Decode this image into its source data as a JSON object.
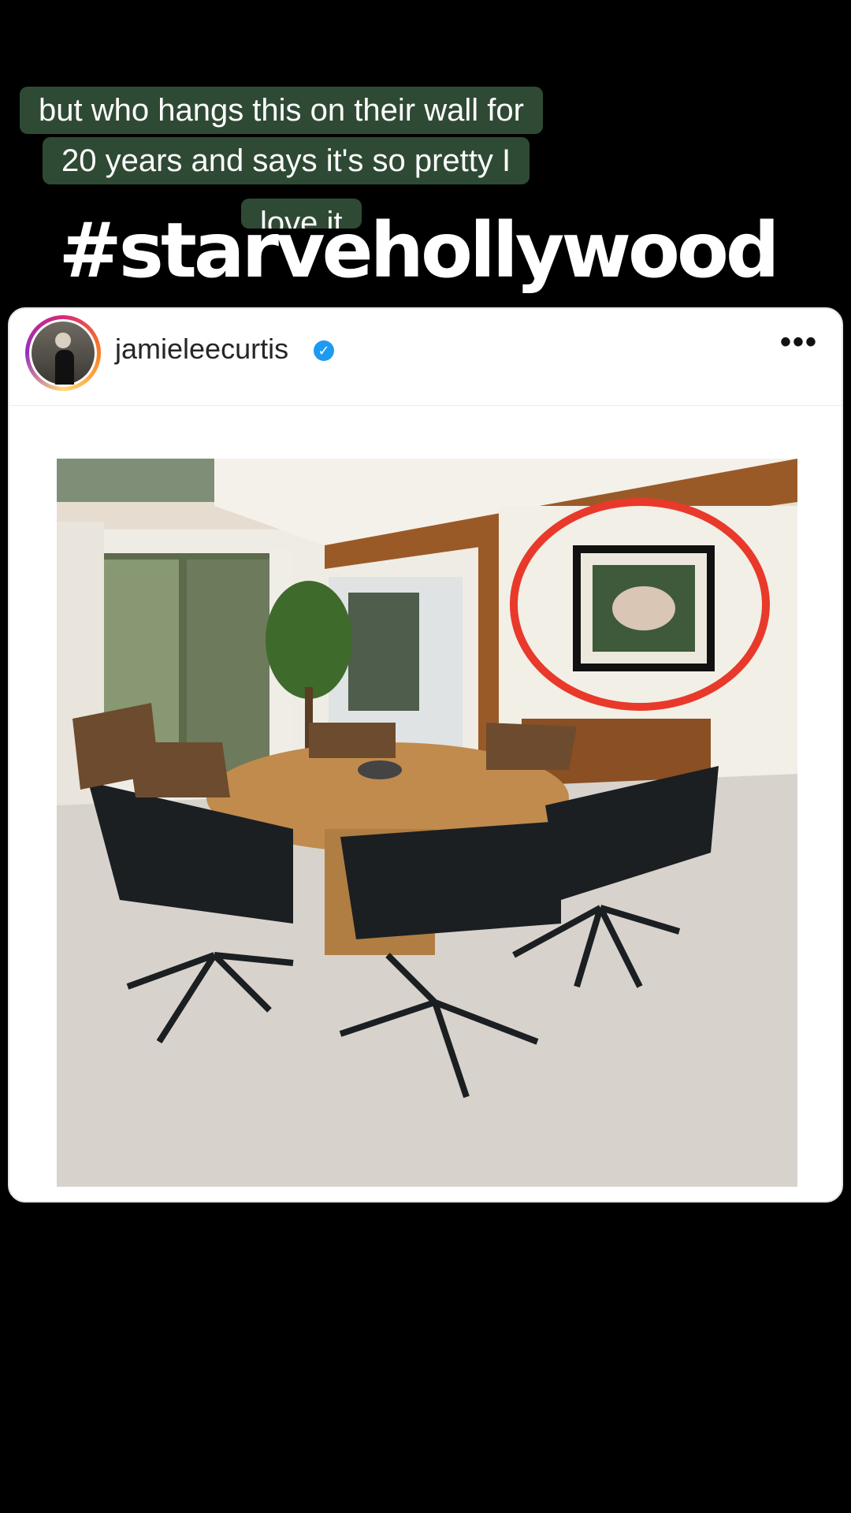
{
  "caption": {
    "line1": "but who hangs this on their wall for",
    "line2": "20 years and says it's so pretty I",
    "line3": "love it"
  },
  "hashtag": "#starvehollywood",
  "post": {
    "username": "jamieleecurtis",
    "verified": true,
    "more_icon": "more-icon",
    "verified_icon": "verified-icon",
    "colors": {
      "verified": "#1d9bf0",
      "caption_bg": "#2f4a34",
      "highlight_circle": "#e8392b"
    }
  }
}
